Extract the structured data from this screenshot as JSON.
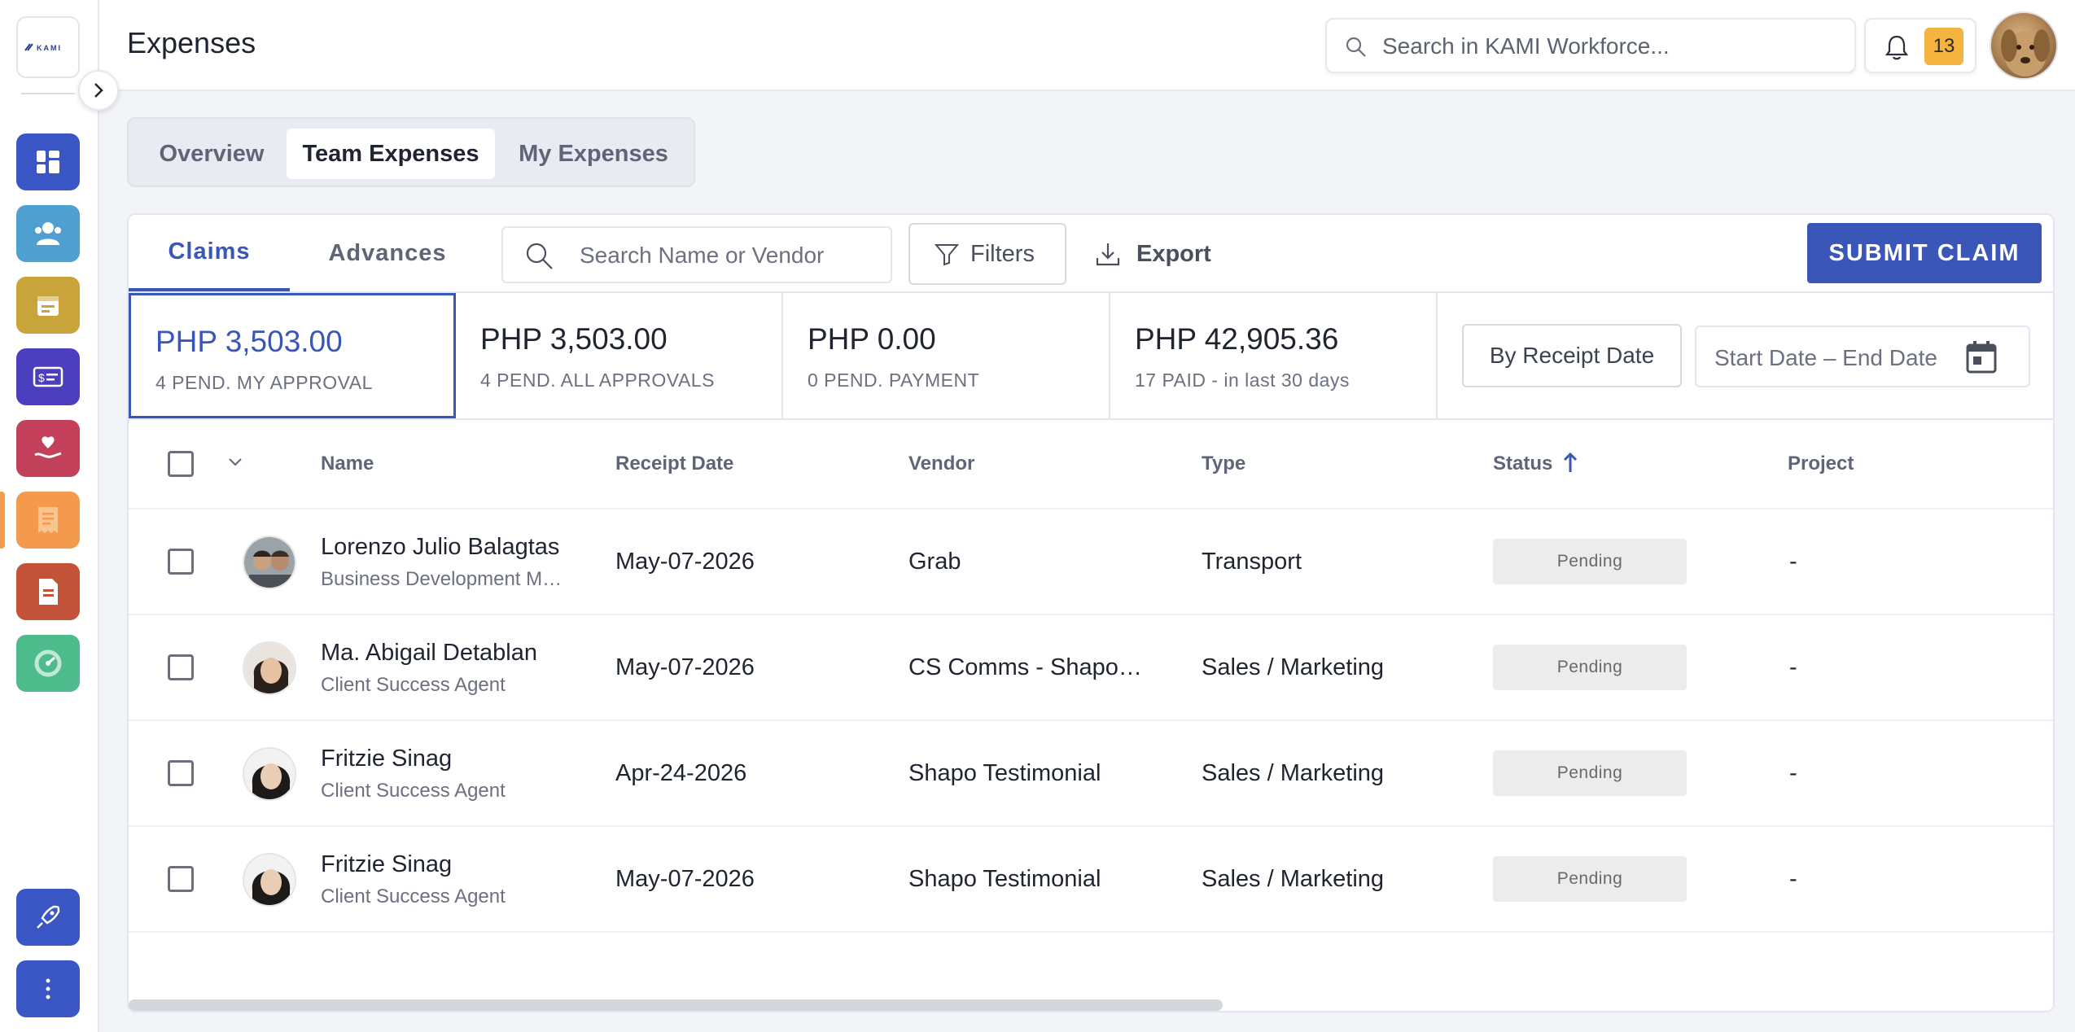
{
  "app": {
    "logo_text": "KAMI",
    "page_title": "Expenses",
    "search_placeholder": "Search in KAMI Workforce...",
    "notification_count": "13"
  },
  "top_tabs": [
    {
      "label": "Overview"
    },
    {
      "label": "Team Expenses"
    },
    {
      "label": "My Expenses"
    }
  ],
  "active_top_tab": "Team Expenses",
  "sub_tabs": [
    {
      "label": "Claims"
    },
    {
      "label": "Advances"
    }
  ],
  "toolbar": {
    "search_placeholder": "Search Name or Vendor",
    "filters_label": "Filters",
    "export_label": "Export",
    "submit_label": "SUBMIT CLAIM"
  },
  "stats": [
    {
      "amount": "PHP 3,503.00",
      "label": "4  PEND. MY APPROVAL"
    },
    {
      "amount": "PHP 3,503.00",
      "label": "4  PEND. ALL APPROVALS"
    },
    {
      "amount": "PHP 0.00",
      "label": "0 PEND. PAYMENT"
    },
    {
      "amount": "PHP 42,905.36",
      "label": "17  PAID  - in last 30 days"
    }
  ],
  "date_filter": {
    "by_label": "By Receipt Date",
    "range_text": "Start Date – End Date"
  },
  "table": {
    "columns": [
      "Name",
      "Receipt Date",
      "Vendor",
      "Type",
      "Status",
      "Project"
    ],
    "rows": [
      {
        "name": "Lorenzo Julio Balagtas",
        "role": "Business Development Manager",
        "date": "May-07-2026",
        "vendor": "Grab",
        "type": "Transport",
        "status": "Pending",
        "project": "-"
      },
      {
        "name": "Ma. Abigail Detablan",
        "role": "Client Success Agent",
        "date": "May-07-2026",
        "vendor": "CS Comms - Shapo Testimonial",
        "type": "Sales / Marketing",
        "status": "Pending",
        "project": "-"
      },
      {
        "name": "Fritzie Sinag",
        "role": "Client Success Agent",
        "date": "Apr-24-2026",
        "vendor": "Shapo Testimonial",
        "type": "Sales / Marketing",
        "status": "Pending",
        "project": "-"
      },
      {
        "name": "Fritzie Sinag",
        "role": "Client Success Agent",
        "date": "May-07-2026",
        "vendor": "Shapo Testimonial",
        "type": "Sales / Marketing",
        "status": "Pending",
        "project": "-"
      }
    ]
  },
  "sidebar": {
    "items": [
      {
        "icon": "dashboard-icon",
        "color": "#3a56c4"
      },
      {
        "icon": "people-icon",
        "color": "#4f9fd0"
      },
      {
        "icon": "calendar-icon",
        "color": "#c9a43a"
      },
      {
        "icon": "payroll-card-icon",
        "color": "#4b3fc0"
      },
      {
        "icon": "heart-hand-icon",
        "color": "#c2405a"
      },
      {
        "icon": "receipt-icon",
        "color": "#f39a4c"
      },
      {
        "icon": "document-icon",
        "color": "#c25238"
      },
      {
        "icon": "gauge-icon",
        "color": "#4dbb8c"
      }
    ],
    "bottom": [
      {
        "icon": "rocket-icon",
        "color": "#3a56c4"
      },
      {
        "icon": "more-vertical-icon",
        "color": "#3a56c4"
      }
    ]
  },
  "colors": {
    "accent": "#3a56b8",
    "pending_badge": "#f5b33f"
  }
}
